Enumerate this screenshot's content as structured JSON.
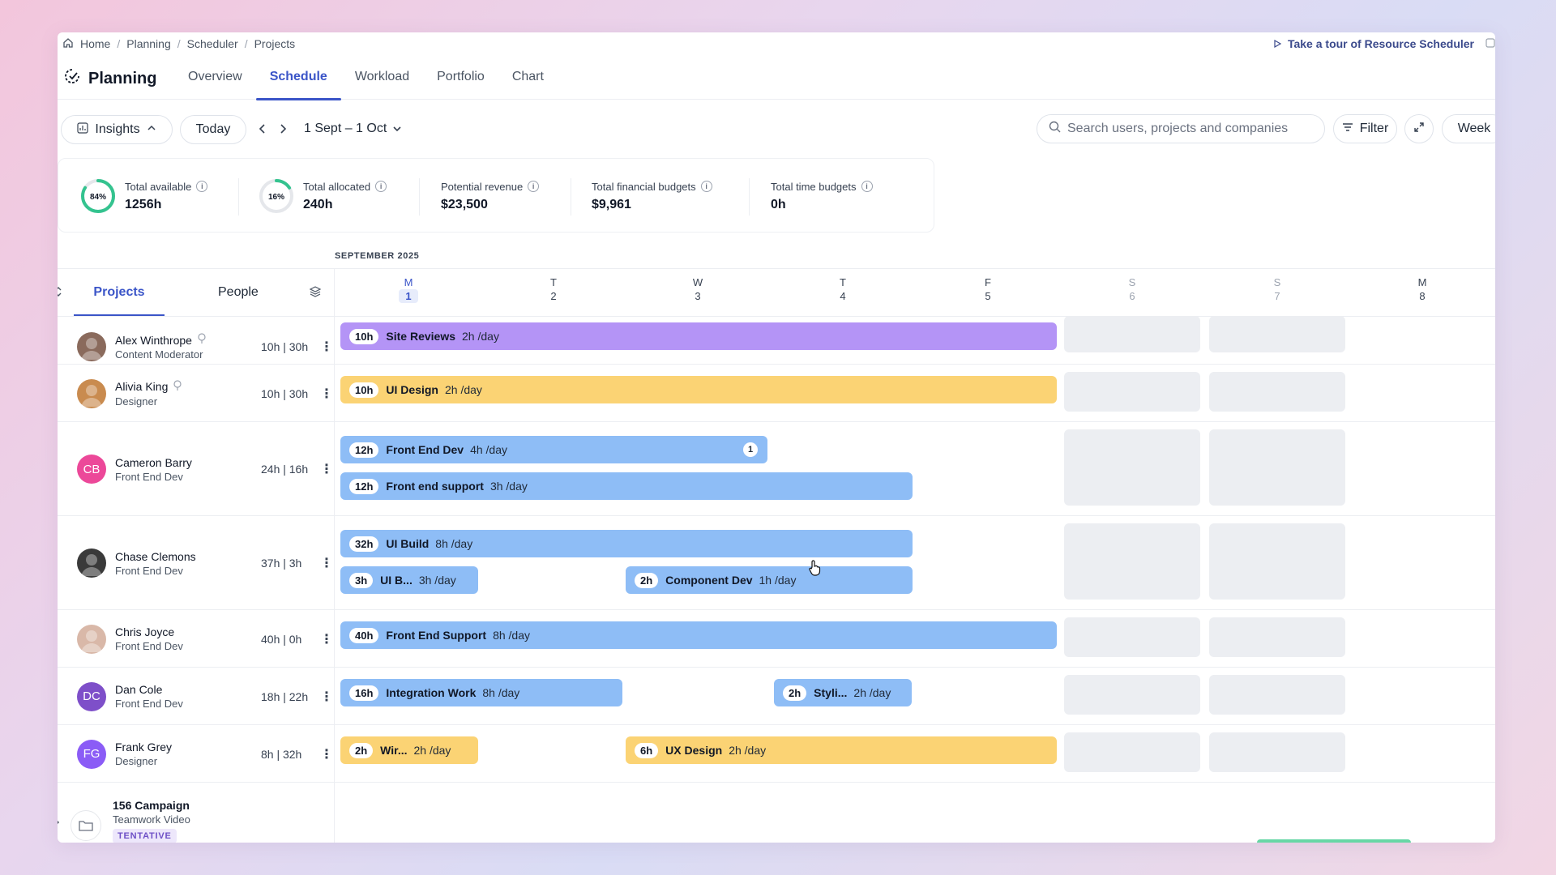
{
  "breadcrumb": [
    "Home",
    "Planning",
    "Scheduler",
    "Projects"
  ],
  "tour_link": "Take a tour of Resource Scheduler",
  "app": {
    "title": "Planning"
  },
  "tabs": [
    {
      "label": "Overview",
      "active": false
    },
    {
      "label": "Schedule",
      "active": true
    },
    {
      "label": "Workload",
      "active": false
    },
    {
      "label": "Portfolio",
      "active": false
    },
    {
      "label": "Chart",
      "active": false
    }
  ],
  "toolbar": {
    "insights": "Insights",
    "today": "Today",
    "date_range": "1 Sept – 1 Oct",
    "search_placeholder": "Search users, projects and companies",
    "filter": "Filter",
    "view": "Week"
  },
  "stats": [
    {
      "label": "Total available",
      "value": "1256h",
      "ring": "84%",
      "ring_fraction": 0.84,
      "ring_color": "#34c38f"
    },
    {
      "label": "Total allocated",
      "value": "240h",
      "ring": "16%",
      "ring_fraction": 0.16,
      "ring_color": "#34c38f"
    },
    {
      "label": "Potential revenue",
      "value": "$23,500"
    },
    {
      "label": "Total financial budgets",
      "value": "$9,961"
    },
    {
      "label": "Total time budgets",
      "value": "0h"
    }
  ],
  "calendar": {
    "month": "SEPTEMBER 2025",
    "left_tabs": {
      "projects": "Projects",
      "people": "People"
    },
    "days": [
      {
        "letter": "M",
        "num": "1",
        "today": true,
        "weekend": false
      },
      {
        "letter": "T",
        "num": "2",
        "today": false,
        "weekend": false
      },
      {
        "letter": "W",
        "num": "3",
        "today": false,
        "weekend": false
      },
      {
        "letter": "T",
        "num": "4",
        "today": false,
        "weekend": false
      },
      {
        "letter": "F",
        "num": "5",
        "today": false,
        "weekend": false
      },
      {
        "letter": "S",
        "num": "6",
        "today": false,
        "weekend": true
      },
      {
        "letter": "S",
        "num": "7",
        "today": false,
        "weekend": true
      },
      {
        "letter": "M",
        "num": "8",
        "today": false,
        "weekend": false
      }
    ]
  },
  "people": [
    {
      "name": "Alex Winthrope",
      "role": "Content Moderator",
      "hours": "10h | 30h",
      "avatar": "photo",
      "pin": true,
      "bars": [
        {
          "hours": "10h",
          "name": "Site Reviews",
          "rate": "2h /day",
          "color": "purple"
        }
      ]
    },
    {
      "name": "Alivia King",
      "role": "Designer",
      "hours": "10h | 30h",
      "avatar": "photo",
      "pin": true,
      "bars": [
        {
          "hours": "10h",
          "name": "UI Design",
          "rate": "2h /day",
          "color": "yellow"
        }
      ]
    },
    {
      "name": "Cameron Barry",
      "role": "Front End Dev",
      "hours": "24h | 16h",
      "avatar": "CB",
      "avatar_color": "#ec4899",
      "bars": [
        {
          "hours": "12h",
          "name": "Front End Dev",
          "rate": "4h /day",
          "color": "blue",
          "count": "1"
        },
        {
          "hours": "12h",
          "name": "Front end support",
          "rate": "3h /day",
          "color": "blue"
        }
      ]
    },
    {
      "name": "Chase Clemons",
      "role": "Front End Dev",
      "hours": "37h | 3h",
      "avatar": "photo",
      "bars": [
        {
          "hours": "32h",
          "name": "UI Build",
          "rate": "8h /day",
          "color": "blue"
        },
        {
          "hours": "3h",
          "name": "UI B...",
          "rate": "3h /day",
          "color": "blue"
        },
        {
          "hours": "2h",
          "name": "Component Dev",
          "rate": "1h /day",
          "color": "blue"
        }
      ]
    },
    {
      "name": "Chris Joyce",
      "role": "Front End Dev",
      "hours": "40h | 0h",
      "avatar": "photo",
      "bars": [
        {
          "hours": "40h",
          "name": "Front End Support",
          "rate": "8h /day",
          "color": "blue"
        }
      ]
    },
    {
      "name": "Dan Cole",
      "role": "Front End Dev",
      "hours": "18h | 22h",
      "avatar": "DC",
      "avatar_color": "#7e4fc9",
      "bars": [
        {
          "hours": "16h",
          "name": "Integration Work",
          "rate": "8h /day",
          "color": "blue"
        },
        {
          "hours": "2h",
          "name": "Styli...",
          "rate": "2h /day",
          "color": "blue"
        }
      ]
    },
    {
      "name": "Frank Grey",
      "role": "Designer",
      "hours": "8h | 32h",
      "avatar": "FG",
      "avatar_color": "#8b5cf6",
      "bars": [
        {
          "hours": "2h",
          "name": "Wir...",
          "rate": "2h /day",
          "color": "yellow"
        },
        {
          "hours": "6h",
          "name": "UX Design",
          "rate": "2h /day",
          "color": "yellow"
        }
      ]
    }
  ],
  "project_group": {
    "name": "156 Campaign",
    "subtitle": "Teamwork Video",
    "status": "TENTATIVE"
  },
  "colors": {
    "accent": "#3b55c8",
    "purple_bar": "#b494f6",
    "yellow_bar": "#fbd374",
    "blue_bar": "#8ebdf6",
    "weekend": "#eceef2"
  }
}
